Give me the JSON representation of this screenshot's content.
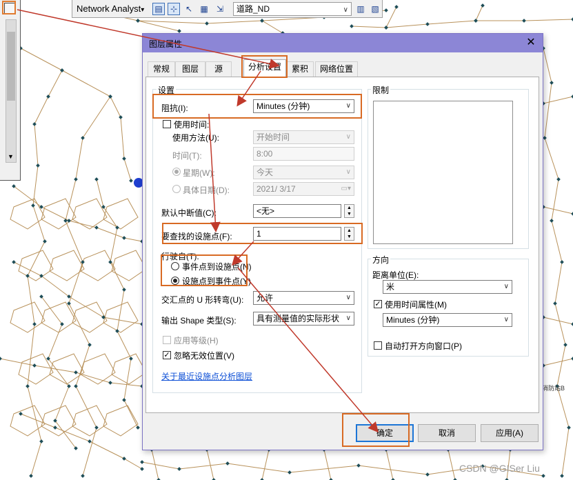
{
  "toolbar": {
    "network_analyst_label": "Network Analyst",
    "dropdown_glyph": "▾",
    "layer_select_value": "道路_ND"
  },
  "dialog": {
    "title": "图层属性",
    "close_glyph": "✕",
    "tabs": [
      "常规",
      "图层",
      "源",
      "分析设置",
      "累积",
      "网络位置"
    ],
    "active_tab": "分析设置",
    "settings": {
      "group_label": "设置",
      "impedance_label": "阻抗(I):",
      "impedance_value": "Minutes (分钟)",
      "use_time_label": "使用时间:",
      "use_time_checked": false,
      "use_method_label": "使用方法(U):",
      "use_method_value": "开始时间",
      "time_label": "时间(T):",
      "time_value": "8:00",
      "weekday_label": "星期(W):",
      "weekday_value": "今天",
      "specific_date_label": "具体日期(D):",
      "specific_date_value": "2021/ 3/17",
      "default_cutoff_label": "默认中断值(C):",
      "default_cutoff_value": "<无>",
      "facilities_to_find_label": "要查找的设施点(F):",
      "facilities_to_find_value": "1",
      "travel_from_label": "行驶自(T):",
      "travel_from_options": [
        "事件点到设施点(N)",
        "设施点到事件点(Y)"
      ],
      "travel_from_selected": 1,
      "uturn_label": "交汇点的 U 形转弯(U):",
      "uturn_value": "允许",
      "output_shape_label": "输出 Shape 类型(S):",
      "output_shape_value": "具有测量值的实际形状",
      "use_hierarchy_label": "应用等级(H)",
      "use_hierarchy_checked": false,
      "ignore_invalid_label": "忽略无效位置(V)",
      "ignore_invalid_checked": true,
      "about_link": "关于最近设施点分析图层"
    },
    "restrictions": {
      "group_label": "限制"
    },
    "directions": {
      "group_label": "方向",
      "distance_units_label": "距离单位(E):",
      "distance_units_value": "米",
      "use_time_attr_label": "使用时间属性(M)",
      "use_time_attr_checked": true,
      "time_attr_value": "Minutes (分钟)",
      "auto_open_label": "自动打开方向窗口(P)",
      "auto_open_checked": false
    },
    "buttons": {
      "ok": "确定",
      "cancel": "取消",
      "apply": "应用(A)"
    }
  },
  "map": {
    "label": "消防站B",
    "node_color": "#1f4e58",
    "road_color": "#b8915a"
  },
  "annotation": {
    "highlight_color": "#d86a23",
    "arrow_color": "#c0392b"
  },
  "watermark": "CSDN @GISer Liu"
}
